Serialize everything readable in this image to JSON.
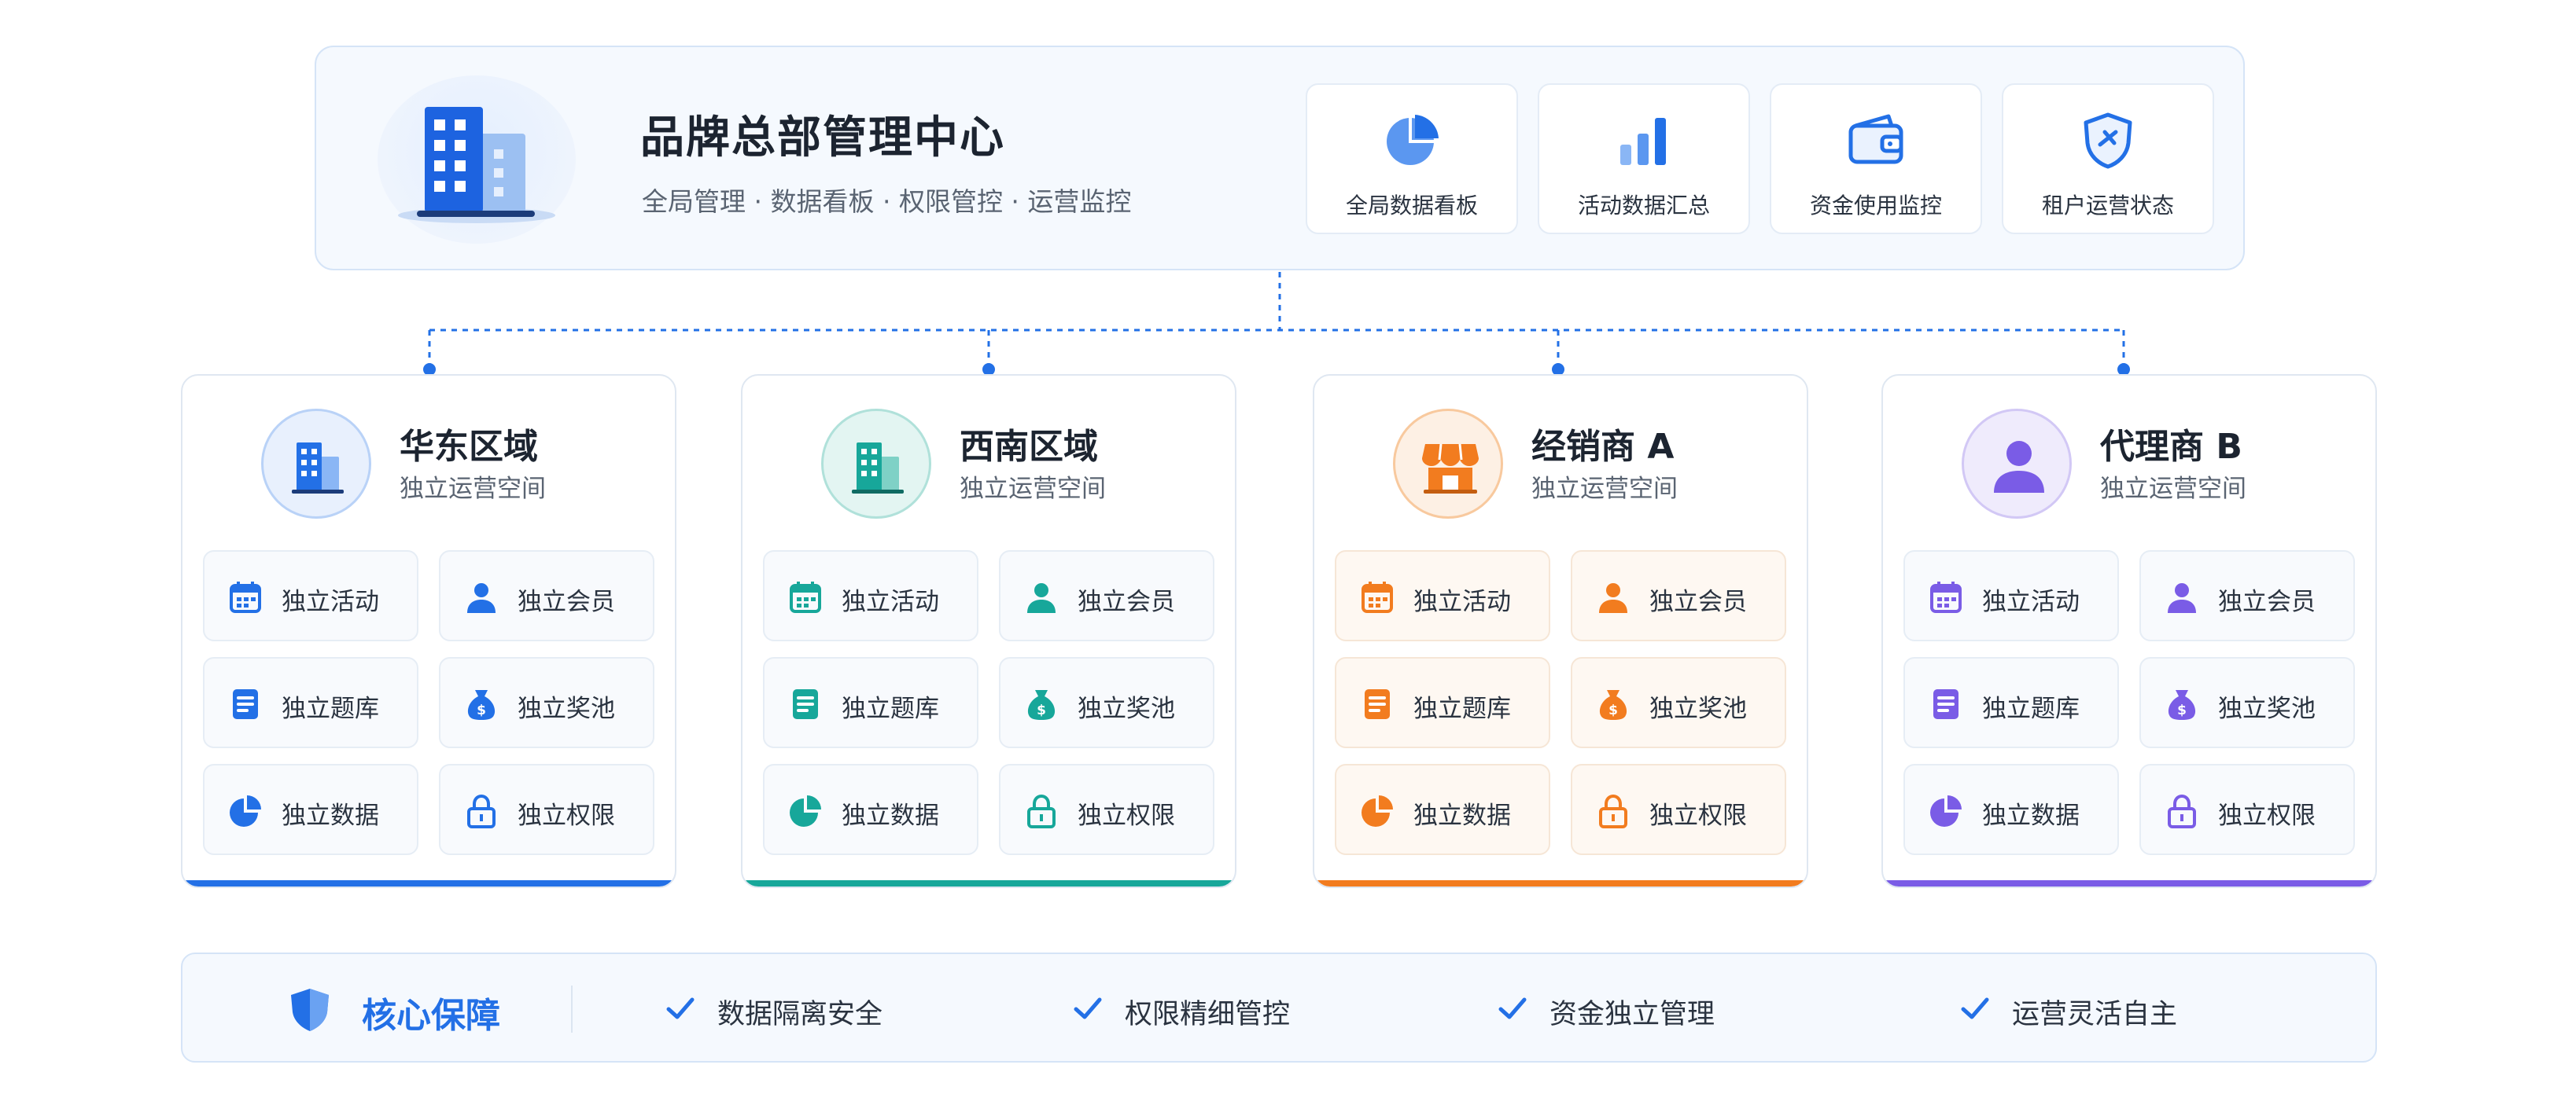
{
  "hq": {
    "title": "品牌总部管理中心",
    "subtitle": "全局管理 · 数据看板 · 权限管控 · 运营监控",
    "cards": [
      {
        "label": "全局数据看板",
        "icon": "pie-chart-icon"
      },
      {
        "label": "活动数据汇总",
        "icon": "bar-chart-icon"
      },
      {
        "label": "资金使用监控",
        "icon": "wallet-icon"
      },
      {
        "label": "租户运营状态",
        "icon": "shield-status-icon"
      }
    ]
  },
  "regions": [
    {
      "name": "华东区域",
      "subtitle": "独立运营空间",
      "color": "#2370e6",
      "tint": "#e8f0fd",
      "emblem": "building-icon",
      "features": [
        "独立活动",
        "独立会员",
        "独立题库",
        "独立奖池",
        "独立数据",
        "独立权限"
      ]
    },
    {
      "name": "西南区域",
      "subtitle": "独立运营空间",
      "color": "#17a79a",
      "tint": "#e3f5f2",
      "emblem": "building-icon",
      "features": [
        "独立活动",
        "独立会员",
        "独立题库",
        "独立奖池",
        "独立数据",
        "独立权限"
      ]
    },
    {
      "name": "经销商 A",
      "subtitle": "独立运营空间",
      "color": "#f27c1f",
      "tint": "#fdf0e4",
      "emblem": "store-icon",
      "features": [
        "独立活动",
        "独立会员",
        "独立题库",
        "独立奖池",
        "独立数据",
        "独立权限"
      ]
    },
    {
      "name": "代理商 B",
      "subtitle": "独立运营空间",
      "color": "#7a5ce6",
      "tint": "#efebfc",
      "emblem": "person-icon",
      "features": [
        "独立活动",
        "独立会员",
        "独立题库",
        "独立奖池",
        "独立数据",
        "独立权限"
      ]
    }
  ],
  "feature_icons": [
    "calendar-icon",
    "user-icon",
    "document-icon",
    "money-bag-icon",
    "pie-chart-icon",
    "lock-icon"
  ],
  "core": {
    "title": "核心保障",
    "items": [
      "数据隔离安全",
      "权限精细管控",
      "资金独立管理",
      "运营灵活自主"
    ]
  },
  "colors": {
    "accent": "#2370e6",
    "border": "#d5e4f7",
    "panel": "#f5f9fe"
  }
}
